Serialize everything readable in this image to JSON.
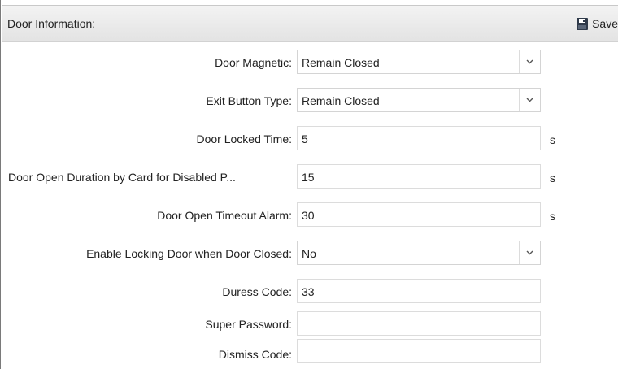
{
  "header": {
    "title": "Door Information:",
    "save_label": "Save"
  },
  "fields": {
    "door_magnetic": {
      "label": "Door Magnetic:",
      "value": "Remain Closed"
    },
    "exit_button_type": {
      "label": "Exit Button Type:",
      "value": "Remain Closed"
    },
    "door_locked_time": {
      "label": "Door Locked Time:",
      "value": "5",
      "unit": "s"
    },
    "door_open_duration_disabled": {
      "label": "Door Open Duration by Card for Disabled P...",
      "value": "15",
      "unit": "s"
    },
    "door_open_timeout_alarm": {
      "label": "Door Open Timeout Alarm:",
      "value": "30",
      "unit": "s"
    },
    "enable_locking_door": {
      "label": "Enable Locking Door when Door Closed:",
      "value": "No"
    },
    "duress_code": {
      "label": "Duress Code:",
      "value": "33"
    },
    "super_password": {
      "label": "Super Password:",
      "value": ""
    },
    "dismiss_code": {
      "label": "Dismiss Code:",
      "value": ""
    }
  },
  "icons": {
    "save": "floppy-disk-icon",
    "dropdown": "chevron-down-icon"
  },
  "colors": {
    "header_bg": "#e8e8e8",
    "border": "#dcdcdc",
    "save_icon": "#2f3a4a"
  }
}
